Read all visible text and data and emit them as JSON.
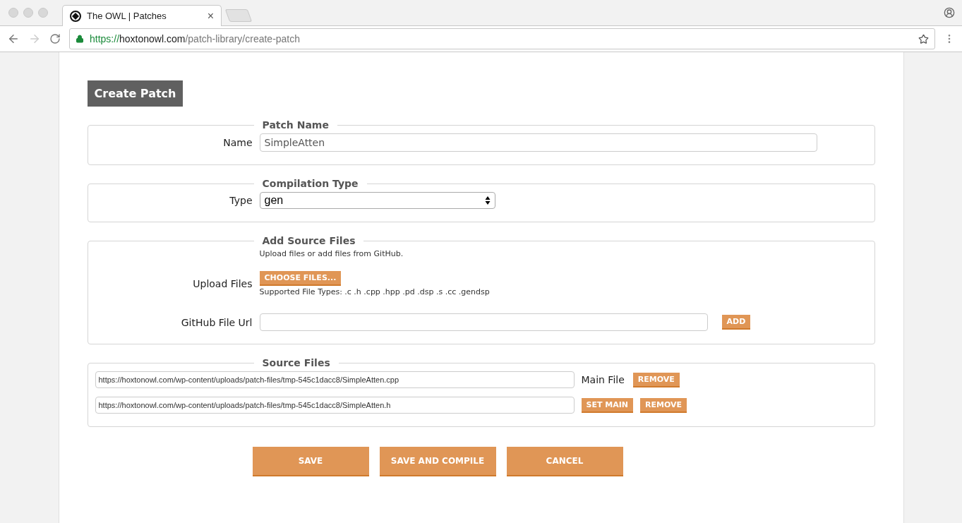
{
  "browser": {
    "tab": {
      "title": "The OWL | Patches",
      "close": "×"
    },
    "url": {
      "scheme": "https://",
      "host": "hoxtonowl.com",
      "path": "/patch-library/create-patch"
    }
  },
  "page_title": "Create Patch",
  "patch_name": {
    "legend": "Patch Name",
    "label": "Name",
    "value": "SimpleAtten"
  },
  "compilation_type": {
    "legend": "Compilation Type",
    "label": "Type",
    "value": "gen"
  },
  "add_source_files": {
    "legend": "Add Source Files",
    "hint": "Upload files or add files from GitHub.",
    "upload_label": "Upload Files",
    "choose_button": "CHOOSE FILES...",
    "supported": "Supported File Types: .c .h .cpp .hpp .pd .dsp .s .cc .gendsp",
    "github_label": "GitHub File Url",
    "add_button": "ADD"
  },
  "source_files": {
    "legend": "Source Files",
    "files": [
      {
        "url": "https://hoxtonowl.com/wp-content/uploads/patch-files/tmp-545c1dacc8/SimpleAtten.cpp",
        "kind": "main",
        "tag": "Main File",
        "remove": "REMOVE"
      },
      {
        "url": "https://hoxtonowl.com/wp-content/uploads/patch-files/tmp-545c1dacc8/SimpleAtten.h",
        "kind": "secondary",
        "tag": "SET MAIN",
        "remove": "REMOVE"
      }
    ]
  },
  "actions": [
    "SAVE",
    "SAVE AND COMPILE",
    "CANCEL"
  ]
}
